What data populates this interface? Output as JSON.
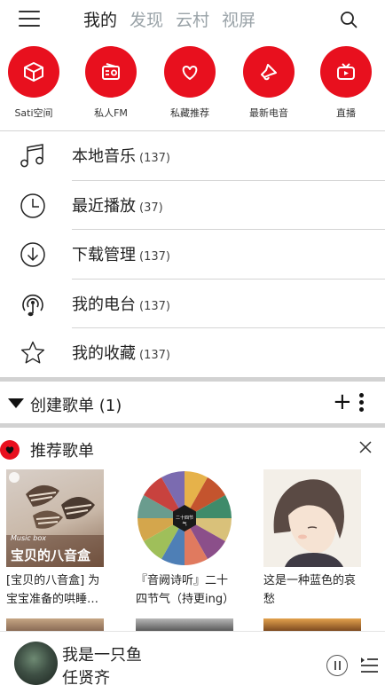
{
  "header": {
    "tabs": [
      {
        "label": "我的",
        "active": true
      },
      {
        "label": "发现",
        "active": false
      },
      {
        "label": "云村",
        "active": false
      },
      {
        "label": "视屏",
        "active": false
      }
    ],
    "icons": {
      "menu": "menu-icon",
      "search": "search-icon"
    }
  },
  "quick_actions": [
    {
      "label": "Sati空间",
      "icon": "cube-icon"
    },
    {
      "label": "私人FM",
      "icon": "radio-icon"
    },
    {
      "label": "私藏推荐",
      "icon": "heart-icon"
    },
    {
      "label": "最新电音",
      "icon": "bell-icon"
    },
    {
      "label": "直播",
      "icon": "tv-icon"
    }
  ],
  "library": [
    {
      "label": "本地音乐",
      "count": "(137)",
      "icon": "music-note-icon"
    },
    {
      "label": "最近播放",
      "count": "(37)",
      "icon": "clock-icon"
    },
    {
      "label": "下载管理",
      "count": "(137)",
      "icon": "download-icon"
    },
    {
      "label": "我的电台",
      "count": "(137)",
      "icon": "podcast-icon"
    },
    {
      "label": "我的收藏",
      "count": "(137)",
      "icon": "star-icon"
    }
  ],
  "created_playlists": {
    "title": "创建歌单 (1)",
    "add_label": "+"
  },
  "recommended": {
    "title": "推荐歌单",
    "cards": [
      {
        "title": "[宝贝的八音盒] 为宝宝准备的哄睡…",
        "cover_caption_small": "Music box",
        "cover_caption": "宝贝的八音盒"
      },
      {
        "title": "『音阙诗听』二十四节气（持更ing）",
        "cover_caption": "二十四节气"
      },
      {
        "title": "这是一种蓝色的哀愁"
      }
    ]
  },
  "player": {
    "song": "我是一只鱼",
    "artist": "任贤齐"
  },
  "colors": {
    "brand": "#e8101e",
    "divider": "#d2d2d2"
  }
}
